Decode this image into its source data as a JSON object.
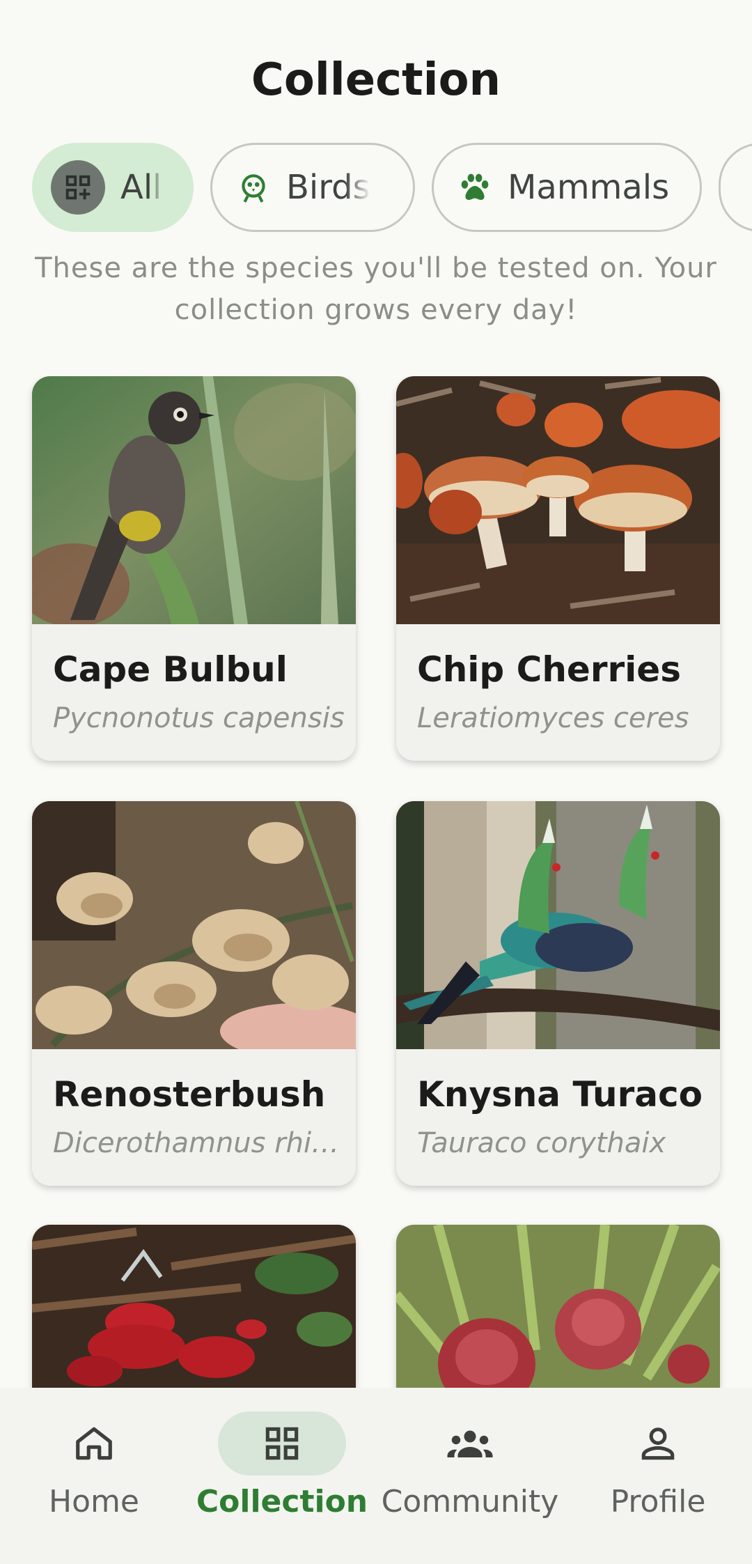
{
  "header": {
    "title": "Collection"
  },
  "filters": {
    "chips": [
      {
        "label": "All",
        "icon": "grid-icon",
        "selected": true
      },
      {
        "label": "Birds",
        "icon": "bird-icon",
        "selected": false
      },
      {
        "label": "Mammals",
        "icon": "paw-icon",
        "selected": false
      }
    ]
  },
  "intro": {
    "text": "These are the species you'll be tested on. Your collection grows every day!"
  },
  "species": [
    {
      "name": "Cape Bulbul",
      "scientific": "Pycnonotus capensis",
      "photo": "cape-bulbul-photo"
    },
    {
      "name": "Chip Cherries",
      "scientific": "Leratiomyces ceres",
      "photo": "chip-cherries-photo"
    },
    {
      "name": "Renosterbush",
      "scientific": "Dicerothamnus rhinocerotis",
      "photo": "renosterbush-photo"
    },
    {
      "name": "Knysna Turaco",
      "scientific": "Tauraco corythaix",
      "photo": "knysna-turaco-photo"
    },
    {
      "name": "",
      "scientific": "",
      "photo": "red-fungus-photo"
    },
    {
      "name": "",
      "scientific": "",
      "photo": "red-protea-photo"
    }
  ],
  "bottom_nav": {
    "items": [
      {
        "label": "Home",
        "icon": "home-icon"
      },
      {
        "label": "Collection",
        "icon": "grid-icon",
        "active": true
      },
      {
        "label": "Community",
        "icon": "group-icon"
      },
      {
        "label": "Profile",
        "icon": "person-icon"
      }
    ]
  },
  "colors": {
    "accent": "#2e7d32",
    "chip_selected_bg": "#d3ecd3",
    "background": "#f9f9f6",
    "card_bg": "#f1f2ed"
  }
}
